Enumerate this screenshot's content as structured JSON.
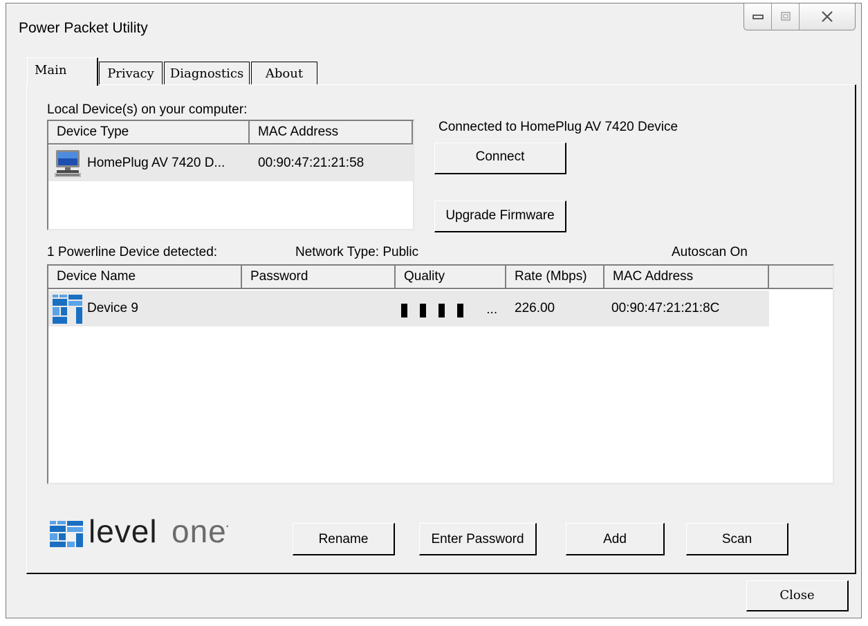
{
  "window": {
    "title": "Power Packet Utility",
    "close_label": "Close"
  },
  "tabs": [
    "Main",
    "Privacy",
    "Diagnostics",
    "About"
  ],
  "local": {
    "label": "Local Device(s) on your computer:",
    "columns": [
      "Device Type",
      "MAC Address"
    ],
    "rows": [
      {
        "device_type": "HomePlug AV 7420 D...",
        "mac": "00:90:47:21:21:58",
        "icon": "computer-icon"
      }
    ]
  },
  "status": {
    "connected_text": "Connected to HomePlug AV 7420 Device"
  },
  "buttons": {
    "connect": "Connect",
    "upgrade": "Upgrade Firmware",
    "rename": "Rename",
    "enter_password": "Enter Password",
    "add": "Add",
    "scan": "Scan"
  },
  "powerline": {
    "detected_text": "1 Powerline Device detected:",
    "network_type": "Network Type: Public",
    "autoscan": "Autoscan On",
    "columns": [
      "Device Name",
      "Password",
      "Quality",
      "Rate (Mbps)",
      "MAC Address"
    ],
    "rows": [
      {
        "name": "Device 9",
        "password": "",
        "quality_bars": 4,
        "quality_suffix": "...",
        "rate": "226.00",
        "mac": "00:90:47:21:21:8C",
        "icon": "levelone-device-icon"
      }
    ]
  },
  "brand": {
    "logo_text_dark": "level",
    "logo_text_light": "one",
    "trademark": "·",
    "color_blue": "#1a6fc2",
    "color_dark": "#1f1f1f",
    "color_gray": "#6b6b6b"
  }
}
